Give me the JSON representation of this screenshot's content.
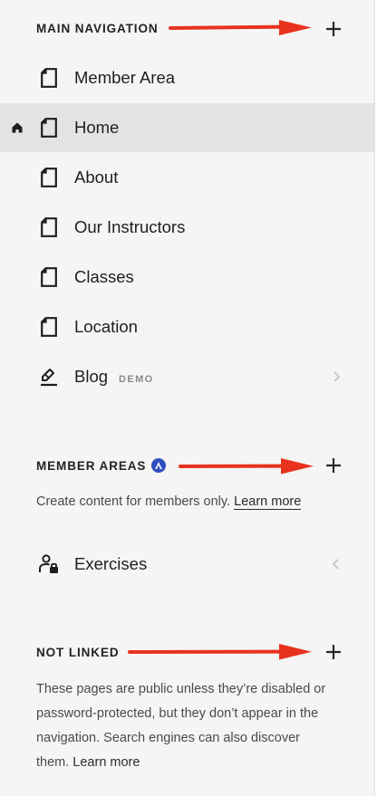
{
  "main_navigation": {
    "title": "MAIN NAVIGATION",
    "add_icon": "plus-icon",
    "items": [
      {
        "label": "Member Area",
        "icon": "page-icon"
      },
      {
        "label": "Home",
        "icon": "page-icon",
        "active": true,
        "home_icon": "home-icon"
      },
      {
        "label": "About",
        "icon": "page-icon"
      },
      {
        "label": "Our Instructors",
        "icon": "page-icon"
      },
      {
        "label": "Classes",
        "icon": "page-icon"
      },
      {
        "label": "Location",
        "icon": "page-icon"
      },
      {
        "label": "Blog",
        "icon": "blog-icon",
        "tag": "DEMO",
        "chevron": "chevron-right-icon"
      }
    ]
  },
  "member_areas": {
    "title": "MEMBER AREAS",
    "badge_icon": "member-areas-badge-icon",
    "description": "Create content for members only.",
    "learn_more": "Learn more",
    "items": [
      {
        "label": "Exercises",
        "icon": "member-lock-icon",
        "chevron": "chevron-left-icon"
      }
    ]
  },
  "not_linked": {
    "title": "NOT LINKED",
    "description": "These pages are public unless they’re disabled or password-protected, but they don’t appear in the navigation. Search engines can also discover them.",
    "learn_more": "Learn more"
  },
  "colors": {
    "panel_bg": "#f5f5f5",
    "active_row_bg": "#e3e3e3",
    "annotation_arrow": "#e8321e",
    "badge": "#2f4fbf"
  }
}
